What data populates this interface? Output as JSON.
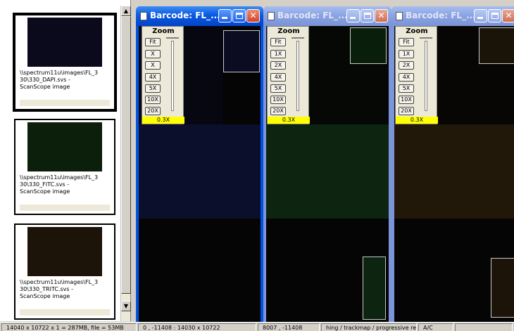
{
  "thumbnails": [
    {
      "caption": "\\\\spectrum11u\\images\\FL_3\n30\\330_DAPI.svs -\nScanScope image",
      "tint": "#0a0a1c",
      "selected": true
    },
    {
      "caption": "\\\\spectrum11u\\images\\FL_3\n30\\330_FITC.svs -\nScanScope image",
      "tint": "#0b1f0b",
      "selected": false
    },
    {
      "caption": "\\\\spectrum11u\\images\\FL_3\n30\\330_TRITC.svs -\nScanScope image",
      "tint": "#1c1408",
      "selected": false
    }
  ],
  "scrollbar": {
    "up_glyph": "▲",
    "down_glyph": "▼"
  },
  "viewers": [
    {
      "title": "Barcode: FL_...",
      "active": true,
      "tint": "#0c0f2c"
    },
    {
      "title": "Barcode: FL_...",
      "active": false,
      "tint": "#0c2410"
    },
    {
      "title": "Barcode: FL_...",
      "active": false,
      "tint": "#22180a"
    }
  ],
  "window_controls": {
    "minimize": "",
    "maximize": "",
    "close": "✕"
  },
  "zoom": {
    "label": "Zoom",
    "buttons": [
      "Fit",
      "1X",
      "2X",
      "4X",
      "5X",
      "10X",
      "20X"
    ],
    "first_viewer_buttons": [
      "Fit",
      "X",
      "X",
      "4X",
      "5X",
      "10X",
      "20X"
    ],
    "value": "0.3X"
  },
  "statusbar": {
    "cells": [
      "14040 x 10722 x 1 = 287MB, file = 53MB",
      "0 , -11408 : 14030 x 10722",
      "8007 , -11408",
      "hing / trackmap / progressive re",
      "A/C",
      ""
    ]
  }
}
